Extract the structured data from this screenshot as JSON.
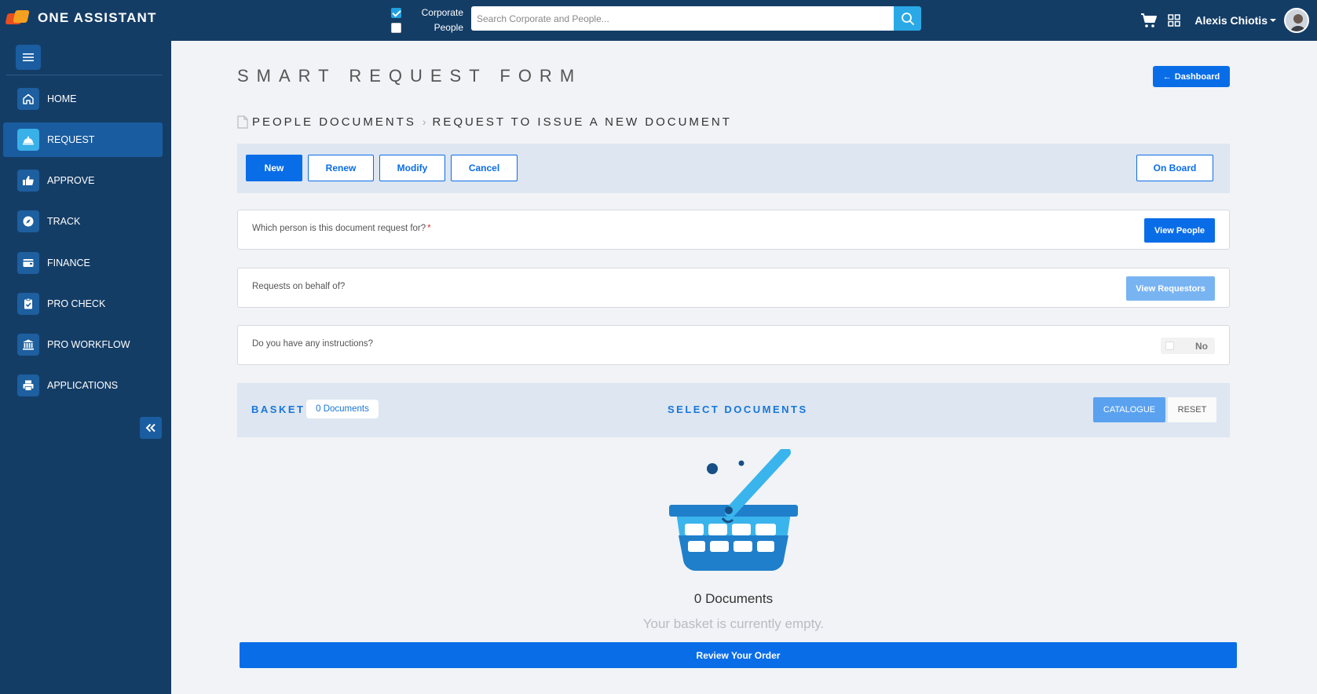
{
  "header": {
    "brand": "ONE ASSISTANT",
    "scope": [
      {
        "label": "Corporate",
        "checked": true
      },
      {
        "label": "People",
        "checked": false
      }
    ],
    "search": {
      "placeholder": "Search Corporate and People..."
    },
    "user": {
      "name": "Alexis Chiotis"
    },
    "icons": [
      "cart-icon",
      "grid-icon",
      "search-icon"
    ]
  },
  "sidebar": {
    "items": [
      {
        "label": "HOME",
        "icon": "home-icon"
      },
      {
        "label": "REQUEST",
        "icon": "bell-icon",
        "active": true
      },
      {
        "label": "APPROVE",
        "icon": "thumbs-up-icon"
      },
      {
        "label": "TRACK",
        "icon": "compass-icon"
      },
      {
        "label": "FINANCE",
        "icon": "wallet-icon"
      },
      {
        "label": "PRO CHECK",
        "icon": "clipboard-check-icon"
      },
      {
        "label": "PRO WORKFLOW",
        "icon": "bank-icon"
      },
      {
        "label": "APPLICATIONS",
        "icon": "printer-icon"
      }
    ]
  },
  "main": {
    "title": "SMART REQUEST FORM",
    "dashboard_label": "Dashboard",
    "breadcrumb": [
      "PEOPLE DOCUMENTS",
      "REQUEST TO ISSUE A NEW DOCUMENT"
    ],
    "actions": [
      {
        "label": "New",
        "active": true
      },
      {
        "label": "Renew"
      },
      {
        "label": "Modify"
      },
      {
        "label": "Cancel"
      }
    ],
    "onboard_label": "On Board",
    "questions": {
      "person": {
        "text": "Which person is this document request for?",
        "required_mark": "*",
        "button": "View People"
      },
      "behalf": {
        "text": "Requests on behalf of?",
        "button": "View Requestors"
      },
      "instructions": {
        "text": "Do you have any instructions?",
        "toggle_value": "No"
      }
    },
    "basket": {
      "title": "BASKET",
      "count_badge": "0 Documents",
      "select_label": "SELECT DOCUMENTS",
      "catalogue_label": "CATALOGUE",
      "reset_label": "RESET",
      "empty_count": "0 Documents",
      "empty_message": "Your basket is currently empty."
    },
    "review_label": "Review Your Order"
  },
  "colors": {
    "navy": "#143d66",
    "primary": "#0a6de8",
    "accent": "#2aa9e6",
    "panel": "#dde6f1"
  }
}
